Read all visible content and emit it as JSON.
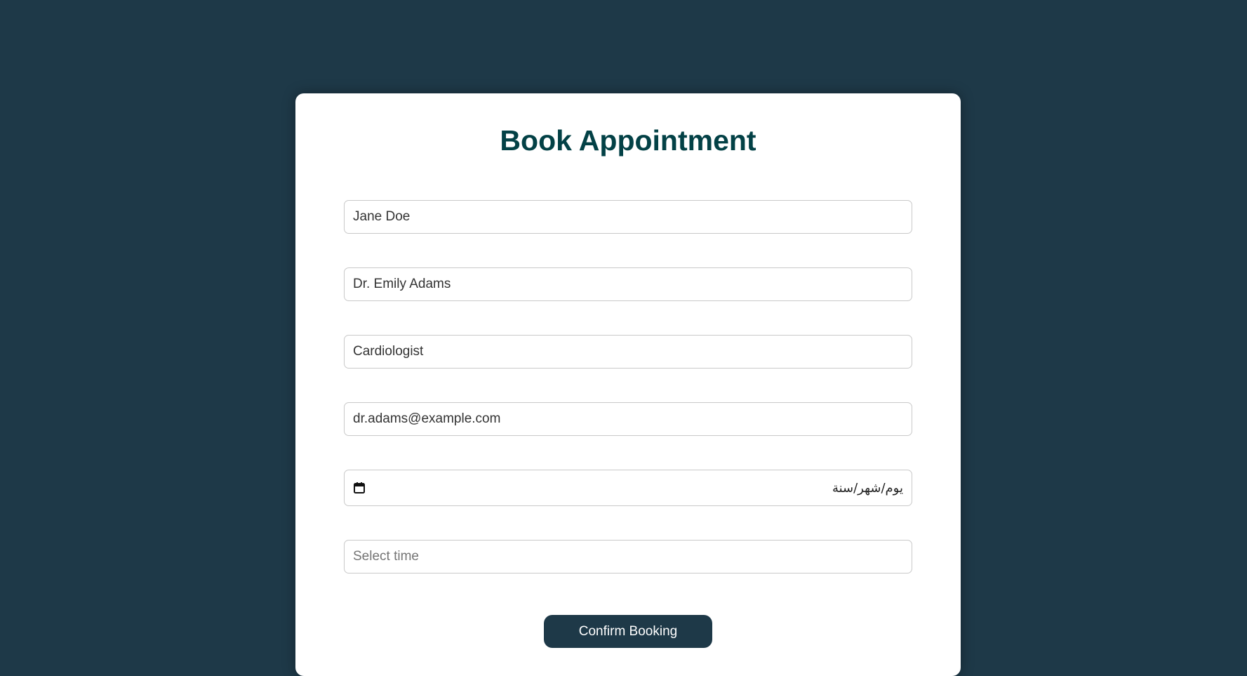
{
  "form": {
    "title": "Book Appointment",
    "fields": {
      "patient_name": {
        "value": "Jane Doe",
        "placeholder": ""
      },
      "doctor_name": {
        "value": "Dr. Emily Adams",
        "placeholder": ""
      },
      "specialty": {
        "value": "Cardiologist",
        "placeholder": ""
      },
      "email": {
        "value": "dr.adams@example.com",
        "placeholder": ""
      },
      "date": {
        "display": "يوم/شهر/سنة",
        "icon": "calendar-icon"
      },
      "time": {
        "value": "",
        "placeholder": "Select time"
      }
    },
    "submit_label": "Confirm Booking"
  },
  "colors": {
    "background": "#1e3948",
    "card": "#ffffff",
    "title": "#034146",
    "button": "#1e3948",
    "button_text": "#ffffff"
  }
}
